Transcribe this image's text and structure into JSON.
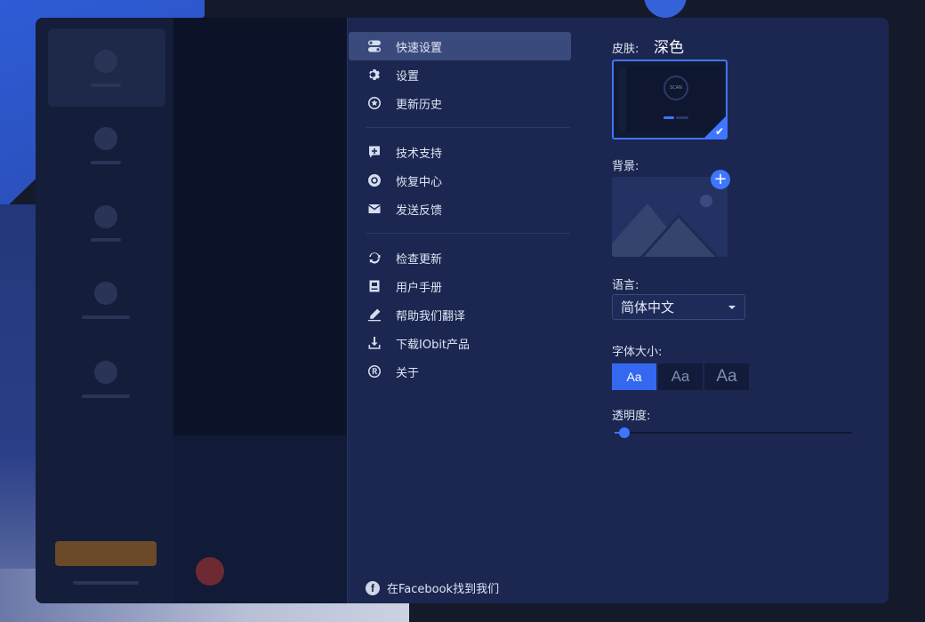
{
  "menu": {
    "items": [
      {
        "label": "快速设置",
        "icon": "toggle-icon"
      },
      {
        "label": "设置",
        "icon": "gear-icon"
      },
      {
        "label": "更新历史",
        "icon": "star-circle-icon"
      },
      {
        "label": "技术支持",
        "icon": "support-chat-icon"
      },
      {
        "label": "恢复中心",
        "icon": "lifebuoy-icon"
      },
      {
        "label": "发送反馈",
        "icon": "envelope-icon"
      },
      {
        "label": "检查更新",
        "icon": "refresh-icon"
      },
      {
        "label": "用户手册",
        "icon": "manual-icon"
      },
      {
        "label": "帮助我们翻译",
        "icon": "pen-icon"
      },
      {
        "label": "下载IObit产品",
        "icon": "download-icon"
      },
      {
        "label": "关于",
        "icon": "registered-icon"
      }
    ],
    "active_index": 0
  },
  "footer": {
    "facebook_label": "在Facebook找到我们"
  },
  "settings": {
    "skin_label": "皮肤:",
    "skin_value": "深色",
    "skin_preview_text": "SCAN",
    "background_label": "背景:",
    "background_add": "+",
    "language_label": "语言:",
    "language_value": "简体中文",
    "font_size_label": "字体大小:",
    "font_options": [
      "Aa",
      "Aa",
      "Aa"
    ],
    "font_selected_index": 0,
    "opacity_label": "透明度:",
    "opacity_value": 0.04
  },
  "colors": {
    "accent": "#3f76ff",
    "panel": "#1b2750",
    "menu_active": "#3b4a7c"
  }
}
